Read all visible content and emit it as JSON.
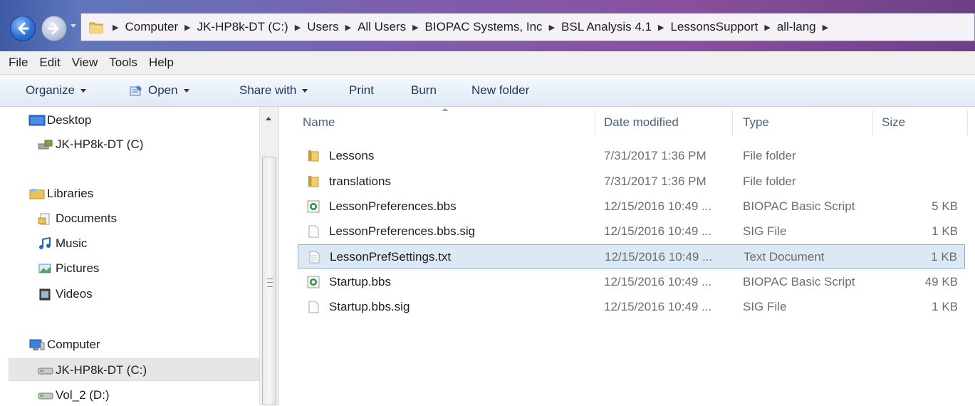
{
  "address": {
    "crumbs": [
      "Computer",
      "JK-HP8k-DT (C:)",
      "Users",
      "All Users",
      "BIOPAC Systems, Inc",
      "BSL Analysis 4.1",
      "LessonsSupport",
      "all-lang"
    ]
  },
  "menu": [
    "File",
    "Edit",
    "View",
    "Tools",
    "Help"
  ],
  "toolbar": {
    "organize": "Organize",
    "open": "Open",
    "share": "Share with",
    "print": "Print",
    "burn": "Burn",
    "new_folder": "New folder"
  },
  "nav": {
    "items": [
      {
        "label": "Desktop",
        "icon": "desktop-icon"
      },
      {
        "label": "JK-HP8k-DT (C)",
        "icon": "homegroup-computer-icon"
      },
      {
        "label": "Libraries",
        "icon": "libraries-icon"
      },
      {
        "label": "Documents",
        "icon": "documents-icon"
      },
      {
        "label": "Music",
        "icon": "music-icon"
      },
      {
        "label": "Pictures",
        "icon": "pictures-icon"
      },
      {
        "label": "Videos",
        "icon": "videos-icon"
      },
      {
        "label": "Computer",
        "icon": "computer-icon"
      },
      {
        "label": "JK-HP8k-DT (C:)",
        "icon": "drive-icon"
      },
      {
        "label": "Vol_2 (D:)",
        "icon": "drive-icon"
      }
    ]
  },
  "columns": {
    "name": "Name",
    "date": "Date modified",
    "type": "Type",
    "size": "Size"
  },
  "files": [
    {
      "name": "Lessons",
      "date": "7/31/2017 1:36 PM",
      "type": "File folder",
      "size": "",
      "icon": "folder-icon"
    },
    {
      "name": "translations",
      "date": "7/31/2017 1:36 PM",
      "type": "File folder",
      "size": "",
      "icon": "folder-icon"
    },
    {
      "name": "LessonPreferences.bbs",
      "date": "12/15/2016 10:49 ...",
      "type": "BIOPAC Basic Script",
      "size": "5 KB",
      "icon": "biopac-script-icon"
    },
    {
      "name": "LessonPreferences.bbs.sig",
      "date": "12/15/2016 10:49 ...",
      "type": "SIG File",
      "size": "1 KB",
      "icon": "file-icon"
    },
    {
      "name": "LessonPrefSettings.txt",
      "date": "12/15/2016 10:49 ...",
      "type": "Text Document",
      "size": "1 KB",
      "icon": "text-file-icon"
    },
    {
      "name": "Startup.bbs",
      "date": "12/15/2016 10:49 ...",
      "type": "BIOPAC Basic Script",
      "size": "49 KB",
      "icon": "biopac-script-icon"
    },
    {
      "name": "Startup.bbs.sig",
      "date": "12/15/2016 10:49 ...",
      "type": "SIG File",
      "size": "1 KB",
      "icon": "file-icon"
    }
  ],
  "selected_file": "LessonPrefSettings.txt"
}
